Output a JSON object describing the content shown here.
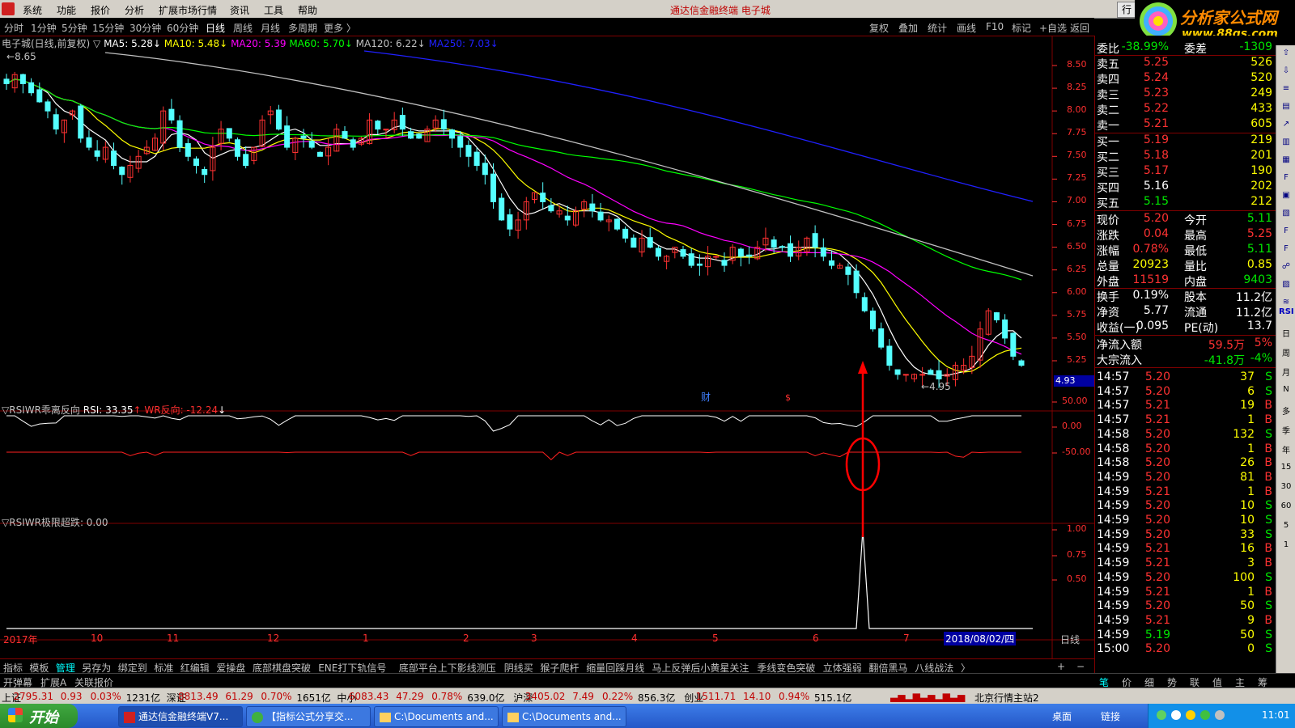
{
  "menubar": {
    "items": [
      "系统",
      "功能",
      "报价",
      "分析",
      "扩展市场行情",
      "资讯",
      "工具",
      "帮助"
    ],
    "title": "通达信金融终端 电子城",
    "hang_button": "行"
  },
  "logo": {
    "brand": "分析家公式网",
    "url_text": "www.88gs.com"
  },
  "periods": [
    "分时",
    "1分钟",
    "5分钟",
    "15分钟",
    "30分钟",
    "60分钟",
    "日线",
    "周线",
    "月线",
    "多周期",
    "更多 〉"
  ],
  "active_period": "日线",
  "right_tools": [
    "复权",
    "叠加",
    "统计",
    "画线",
    "F10",
    "标记",
    "+自选",
    "返回"
  ],
  "main_chart": {
    "title": "电子城(日线,前复权)",
    "ma": [
      {
        "label": "MA5: 5.28",
        "color": "#ffffff"
      },
      {
        "label": "MA10: 5.48",
        "color": "#ffff00"
      },
      {
        "label": "MA20: 5.39",
        "color": "#ff00ff"
      },
      {
        "label": "MA60: 5.70",
        "color": "#00ff00"
      },
      {
        "label": "MA120: 6.22",
        "color": "#c0c0c0"
      },
      {
        "label": "MA250: 7.03",
        "color": "#2020ff"
      }
    ],
    "high_label": "8.65",
    "low_label": "4.95",
    "cursor_price": "4.93",
    "marker_cai": "财",
    "marker_s": "$",
    "y_ticks": [
      "8.50",
      "8.25",
      "8.00",
      "7.75",
      "7.50",
      "7.25",
      "7.00",
      "6.75",
      "6.50",
      "6.25",
      "6.00",
      "5.75",
      "5.50",
      "5.25"
    ]
  },
  "indicator1": {
    "name": "RSIWR乖离反向",
    "rsi_label": "RSI: 33.35",
    "wr_label": "WR反向: -12.24",
    "y_ticks": [
      "50.00",
      "0.00",
      "-50.00"
    ]
  },
  "indicator2": {
    "name": "RSIWR极限超跌",
    "value": ": 0.00",
    "y_ticks": [
      "1.00",
      "0.75",
      "0.50"
    ]
  },
  "x_axis": {
    "labels": [
      "2017年",
      "10",
      "11",
      "12",
      "1",
      "2",
      "3",
      "4",
      "5",
      "6",
      "7"
    ],
    "current_date": "2018/08/02/四",
    "period_tag": "日线"
  },
  "order_book": {
    "ratio": {
      "label": "委比",
      "value": "-38.99%",
      "label2": "委差",
      "value2": "-1309"
    },
    "asks": [
      {
        "label": "卖五",
        "price": "5.25",
        "vol": "526"
      },
      {
        "label": "卖四",
        "price": "5.24",
        "vol": "520"
      },
      {
        "label": "卖三",
        "price": "5.23",
        "vol": "249"
      },
      {
        "label": "卖二",
        "price": "5.22",
        "vol": "433"
      },
      {
        "label": "卖一",
        "price": "5.21",
        "vol": "605"
      }
    ],
    "bids": [
      {
        "label": "买一",
        "price": "5.19",
        "vol": "219"
      },
      {
        "label": "买二",
        "price": "5.18",
        "vol": "201"
      },
      {
        "label": "买三",
        "price": "5.17",
        "vol": "190"
      },
      {
        "label": "买四",
        "price": "5.16",
        "vol": "202"
      },
      {
        "label": "买五",
        "price": "5.15",
        "vol": "212"
      }
    ]
  },
  "quote": [
    {
      "l1": "现价",
      "v1": "5.20",
      "l2": "今开",
      "v2": "5.11"
    },
    {
      "l1": "涨跌",
      "v1": "0.04",
      "l2": "最高",
      "v2": "5.25"
    },
    {
      "l1": "涨幅",
      "v1": "0.78%",
      "l2": "最低",
      "v2": "5.11"
    },
    {
      "l1": "总量",
      "v1": "20923",
      "l2": "量比",
      "v2": "0.85"
    },
    {
      "l1": "外盘",
      "v1": "11519",
      "l2": "内盘",
      "v2": "9403"
    }
  ],
  "fundamentals": [
    {
      "l1": "换手",
      "v1": "0.19%",
      "l2": "股本",
      "v2": "11.2亿"
    },
    {
      "l1": "净资",
      "v1": "5.77",
      "l2": "流通",
      "v2": "11.2亿"
    },
    {
      "l1": "收益(一)",
      "v1": "0.095",
      "l2": "PE(动)",
      "v2": "13.7"
    }
  ],
  "flows": [
    {
      "label": "净流入额",
      "value": "59.5万",
      "pct": "5%"
    },
    {
      "label": "大宗流入",
      "value": "-41.8万",
      "pct": "-4%"
    }
  ],
  "ticks": [
    {
      "t": "14:57",
      "p": "5.20",
      "v": "37",
      "s": "S"
    },
    {
      "t": "14:57",
      "p": "5.20",
      "v": "6",
      "s": "S"
    },
    {
      "t": "14:57",
      "p": "5.21",
      "v": "19",
      "s": "B"
    },
    {
      "t": "14:57",
      "p": "5.21",
      "v": "1",
      "s": "B"
    },
    {
      "t": "14:58",
      "p": "5.20",
      "v": "132",
      "s": "S"
    },
    {
      "t": "14:58",
      "p": "5.20",
      "v": "1",
      "s": "B"
    },
    {
      "t": "14:58",
      "p": "5.20",
      "v": "26",
      "s": "B"
    },
    {
      "t": "14:59",
      "p": "5.20",
      "v": "81",
      "s": "B"
    },
    {
      "t": "14:59",
      "p": "5.21",
      "v": "1",
      "s": "B"
    },
    {
      "t": "14:59",
      "p": "5.20",
      "v": "10",
      "s": "S"
    },
    {
      "t": "14:59",
      "p": "5.20",
      "v": "10",
      "s": "S"
    },
    {
      "t": "14:59",
      "p": "5.20",
      "v": "33",
      "s": "S"
    },
    {
      "t": "14:59",
      "p": "5.21",
      "v": "16",
      "s": "B"
    },
    {
      "t": "14:59",
      "p": "5.21",
      "v": "3",
      "s": "B"
    },
    {
      "t": "14:59",
      "p": "5.20",
      "v": "100",
      "s": "S"
    },
    {
      "t": "14:59",
      "p": "5.21",
      "v": "1",
      "s": "B"
    },
    {
      "t": "14:59",
      "p": "5.20",
      "v": "50",
      "s": "S"
    },
    {
      "t": "14:59",
      "p": "5.21",
      "v": "9",
      "s": "B"
    },
    {
      "t": "14:59",
      "p": "5.19",
      "v": "50",
      "s": "S"
    },
    {
      "t": "15:00",
      "p": "5.20",
      "v": "0",
      "s": "S"
    }
  ],
  "side_tools": [
    "RSI",
    "日",
    "周",
    "月",
    "N",
    "多",
    "季",
    "年",
    "15",
    "30",
    "60",
    "5",
    "1"
  ],
  "bottom_tabs": [
    "指标",
    "模板",
    "管理",
    "另存为",
    "绑定到",
    "标准",
    "红编辑",
    "爱操盘",
    "底部棋盘突破",
    "ENE打下轨信号",
    "底部平台上下影线测压",
    "阴线买",
    "猴子爬杆",
    "缩量回踩月线",
    "马上反弹后小黄星关注",
    "季线变色突破",
    "立体强弱",
    "翻倍黑马",
    "八线战法",
    "〉"
  ],
  "bottom_tabs_active": "管理",
  "bottom2": [
    "开弹幕",
    "扩展A",
    "关联报价"
  ],
  "bottom2_right": [
    "笔",
    "价",
    "细",
    "势",
    "联",
    "值",
    "主",
    "筹"
  ],
  "statusbar": {
    "sh": {
      "name": "上证",
      "idx": "2795.31",
      "chg": "0.93",
      "pct": "0.03%",
      "amt": "1231亿"
    },
    "sz": {
      "name": "深证",
      "idx": "8813.49",
      "chg": "61.29",
      "pct": "0.70%",
      "amt": "1651亿"
    },
    "zx": {
      "name": "中小",
      "idx": "6083.43",
      "chg": "47.29",
      "pct": "0.78%",
      "amt": "639.0亿"
    },
    "hs": {
      "name": "沪深",
      "idx": "3405.02",
      "chg": "7.49",
      "pct": "0.22%",
      "amt": "856.3亿"
    },
    "cy": {
      "name": "创业",
      "idx": "1511.71",
      "chg": "14.10",
      "pct": "0.94%",
      "amt": "515.1亿"
    },
    "server": "北京行情主站2"
  },
  "taskbar": {
    "start": "开始",
    "tasks": [
      "通达信金融终端V7...",
      "【指标公式分享交...",
      "C:\\Documents and...",
      "C:\\Documents and..."
    ],
    "tray_labels": [
      "桌面",
      "链接"
    ],
    "clock": "11:01"
  },
  "price_series": {
    "note": "approximate daily closes Sep 2017 - Aug 2018",
    "closes": [
      8.3,
      8.4,
      8.3,
      8.2,
      8.1,
      8.0,
      7.8,
      7.9,
      8.0,
      7.7,
      7.6,
      7.5,
      7.6,
      7.4,
      7.3,
      7.4,
      7.5,
      7.6,
      7.7,
      8.0,
      7.9,
      7.6,
      7.5,
      7.4,
      7.3,
      7.6,
      7.8,
      7.7,
      7.5,
      7.4,
      7.6,
      7.9,
      8.0,
      7.8,
      7.6,
      7.7,
      7.7,
      7.6,
      7.5,
      7.6,
      7.8,
      7.7,
      7.6,
      7.7,
      7.9,
      7.8,
      7.8,
      7.9,
      7.8,
      7.7,
      7.7,
      7.8,
      7.9,
      7.8,
      7.7,
      7.6,
      7.5,
      7.4,
      7.3,
      7.0,
      6.8,
      6.7,
      6.8,
      7.0,
      7.1,
      7.0,
      6.9,
      6.9,
      6.8,
      6.9,
      7.0,
      6.9,
      6.8,
      6.8,
      6.7,
      6.6,
      6.5,
      6.6,
      6.5,
      6.4,
      6.4,
      6.5,
      6.4,
      6.3,
      6.3,
      6.4,
      6.4,
      6.3,
      6.5,
      6.4,
      6.4,
      6.5,
      6.6,
      6.5,
      6.5,
      6.4,
      6.5,
      6.6,
      6.5,
      6.4,
      6.3,
      6.3,
      6.2,
      6.0,
      5.8,
      5.6,
      5.4,
      5.2,
      5.1,
      5.1,
      5.1,
      5.1,
      5.1,
      5.05,
      5.1,
      5.2,
      5.2,
      5.3,
      5.6,
      5.8,
      5.7,
      5.5,
      5.3,
      5.2
    ]
  }
}
